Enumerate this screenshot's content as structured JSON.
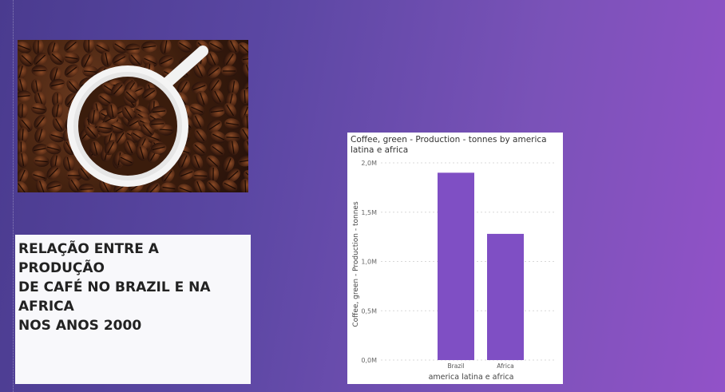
{
  "text_card": {
    "title": "RELAÇÃO ENTRE A PRODUÇÃO\nDE CAFÉ NO BRAZIL E NA\nAFRICA\nNOS ANOS 2000"
  },
  "image": {
    "icon": "coffee-beans-cup-photo"
  },
  "chart_data": {
    "type": "bar",
    "title": "Coffee, green - Production - tonnes by america latina e africa",
    "xlabel": "america latina e africa",
    "ylabel": "Coffee, green - Production - tonnes",
    "categories": [
      "Brazil",
      "Africa"
    ],
    "values": [
      1900000,
      1280000
    ],
    "ylim": [
      0,
      2000000
    ],
    "yticks": [
      "0,0M",
      "0,5M",
      "1,0M",
      "1,5M",
      "2,0M"
    ],
    "ytick_values": [
      0,
      500000,
      1000000,
      1500000,
      2000000
    ],
    "grid": true,
    "bar_color": "#7f4fc4"
  }
}
